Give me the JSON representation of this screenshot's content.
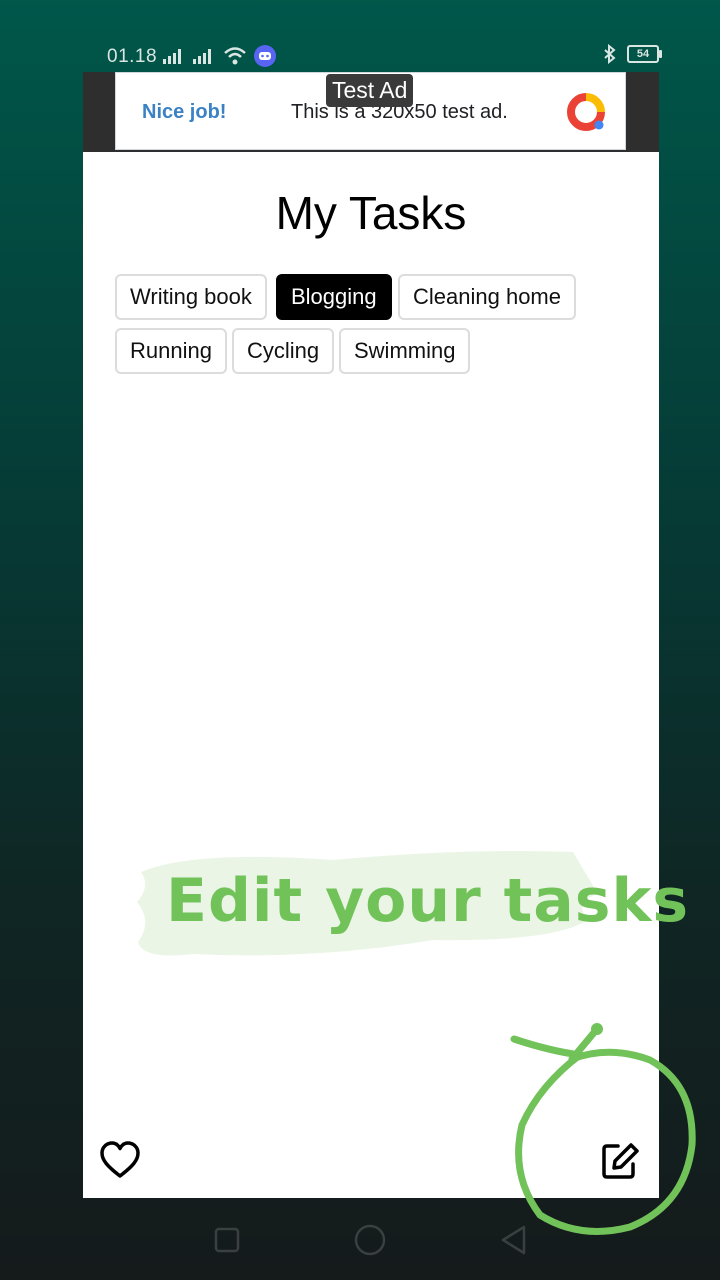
{
  "status_bar": {
    "time": "01.18",
    "battery": "54"
  },
  "ad": {
    "label": "Test Ad",
    "cta": "Nice job!",
    "text": "This is a 320x50 test ad."
  },
  "app": {
    "title": "My Tasks",
    "tasks": [
      {
        "label": "Writing book",
        "selected": false
      },
      {
        "label": "Blogging",
        "selected": true
      },
      {
        "label": "Cleaning home",
        "selected": false
      },
      {
        "label": "Running",
        "selected": false
      },
      {
        "label": "Cycling",
        "selected": false
      },
      {
        "label": "Swimming",
        "selected": false
      }
    ],
    "hint": "Edit your tasks",
    "bottom_bar": {
      "left_icon": "heart-icon",
      "right_icon": "edit-icon"
    }
  },
  "colors": {
    "hint": "#72c25a",
    "selected_chip": "#000000",
    "ad_cta": "#3b82c4"
  }
}
